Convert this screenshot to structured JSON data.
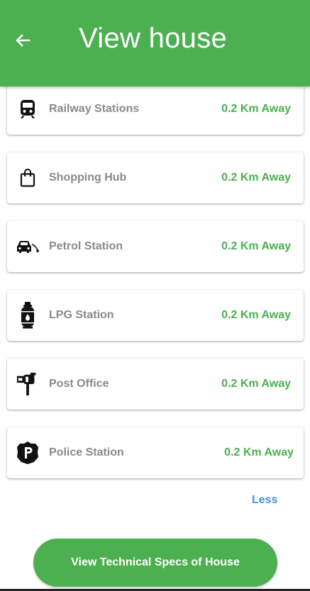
{
  "header": {
    "title": "View house",
    "back_icon": "arrow-left-icon",
    "bg_color": "#4caf50"
  },
  "amenities": [
    {
      "name": "Railway Stations",
      "distance": "0.2 Km Away",
      "icon": "train-icon"
    },
    {
      "name": "Shopping Hub",
      "distance": "0.2 Km Away",
      "icon": "shopping-bag-icon"
    },
    {
      "name": "Petrol Station",
      "distance": "0.2 Km Away",
      "icon": "fuel-car-icon"
    },
    {
      "name": "LPG Station",
      "distance": "0.2 Km Away",
      "icon": "gas-cylinder-icon"
    },
    {
      "name": "Post Office",
      "distance": "0.2 Km Away",
      "icon": "mailbox-icon"
    },
    {
      "name": "Police Station",
      "distance": "0.2 Km Away",
      "icon": "police-badge-icon"
    }
  ],
  "less_link": "Less",
  "specs_button": "View Technical Specs of House",
  "colors": {
    "accent": "#4caf50",
    "link": "#4a90d9",
    "label": "#8a8a8a"
  }
}
